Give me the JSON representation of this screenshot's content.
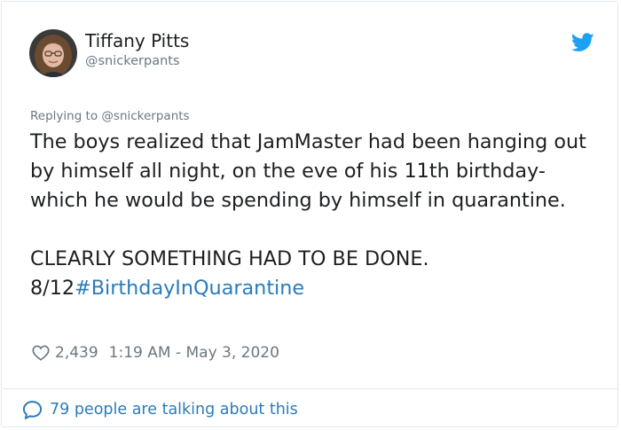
{
  "author": {
    "name": "Tiffany Pitts",
    "handle": "@snickerpants",
    "avatar_icon": "profile-photo"
  },
  "brand": {
    "icon": "twitter-bird-icon",
    "color": "#1da1f2"
  },
  "reply": {
    "prefix": "Replying to",
    "handle": "@snickerpants"
  },
  "tweet": {
    "paragraph1": "The boys realized that JamMaster had been hanging out by himself all night, on the eve of his 11th birthday- which he would be spending by himself in quarantine.",
    "paragraph2": "CLEARLY SOMETHING HAD TO BE DONE.",
    "counter": "8/12",
    "hashtag": "#BirthdayInQuarantine"
  },
  "meta": {
    "likes": "2,439",
    "timestamp": "1:19 AM - May 3, 2020"
  },
  "footer": {
    "label": "79 people are talking about this"
  },
  "colors": {
    "text": "#1c2022",
    "secondary": "#697882",
    "link": "#2b7bb9",
    "border": "#e1e8ed"
  }
}
